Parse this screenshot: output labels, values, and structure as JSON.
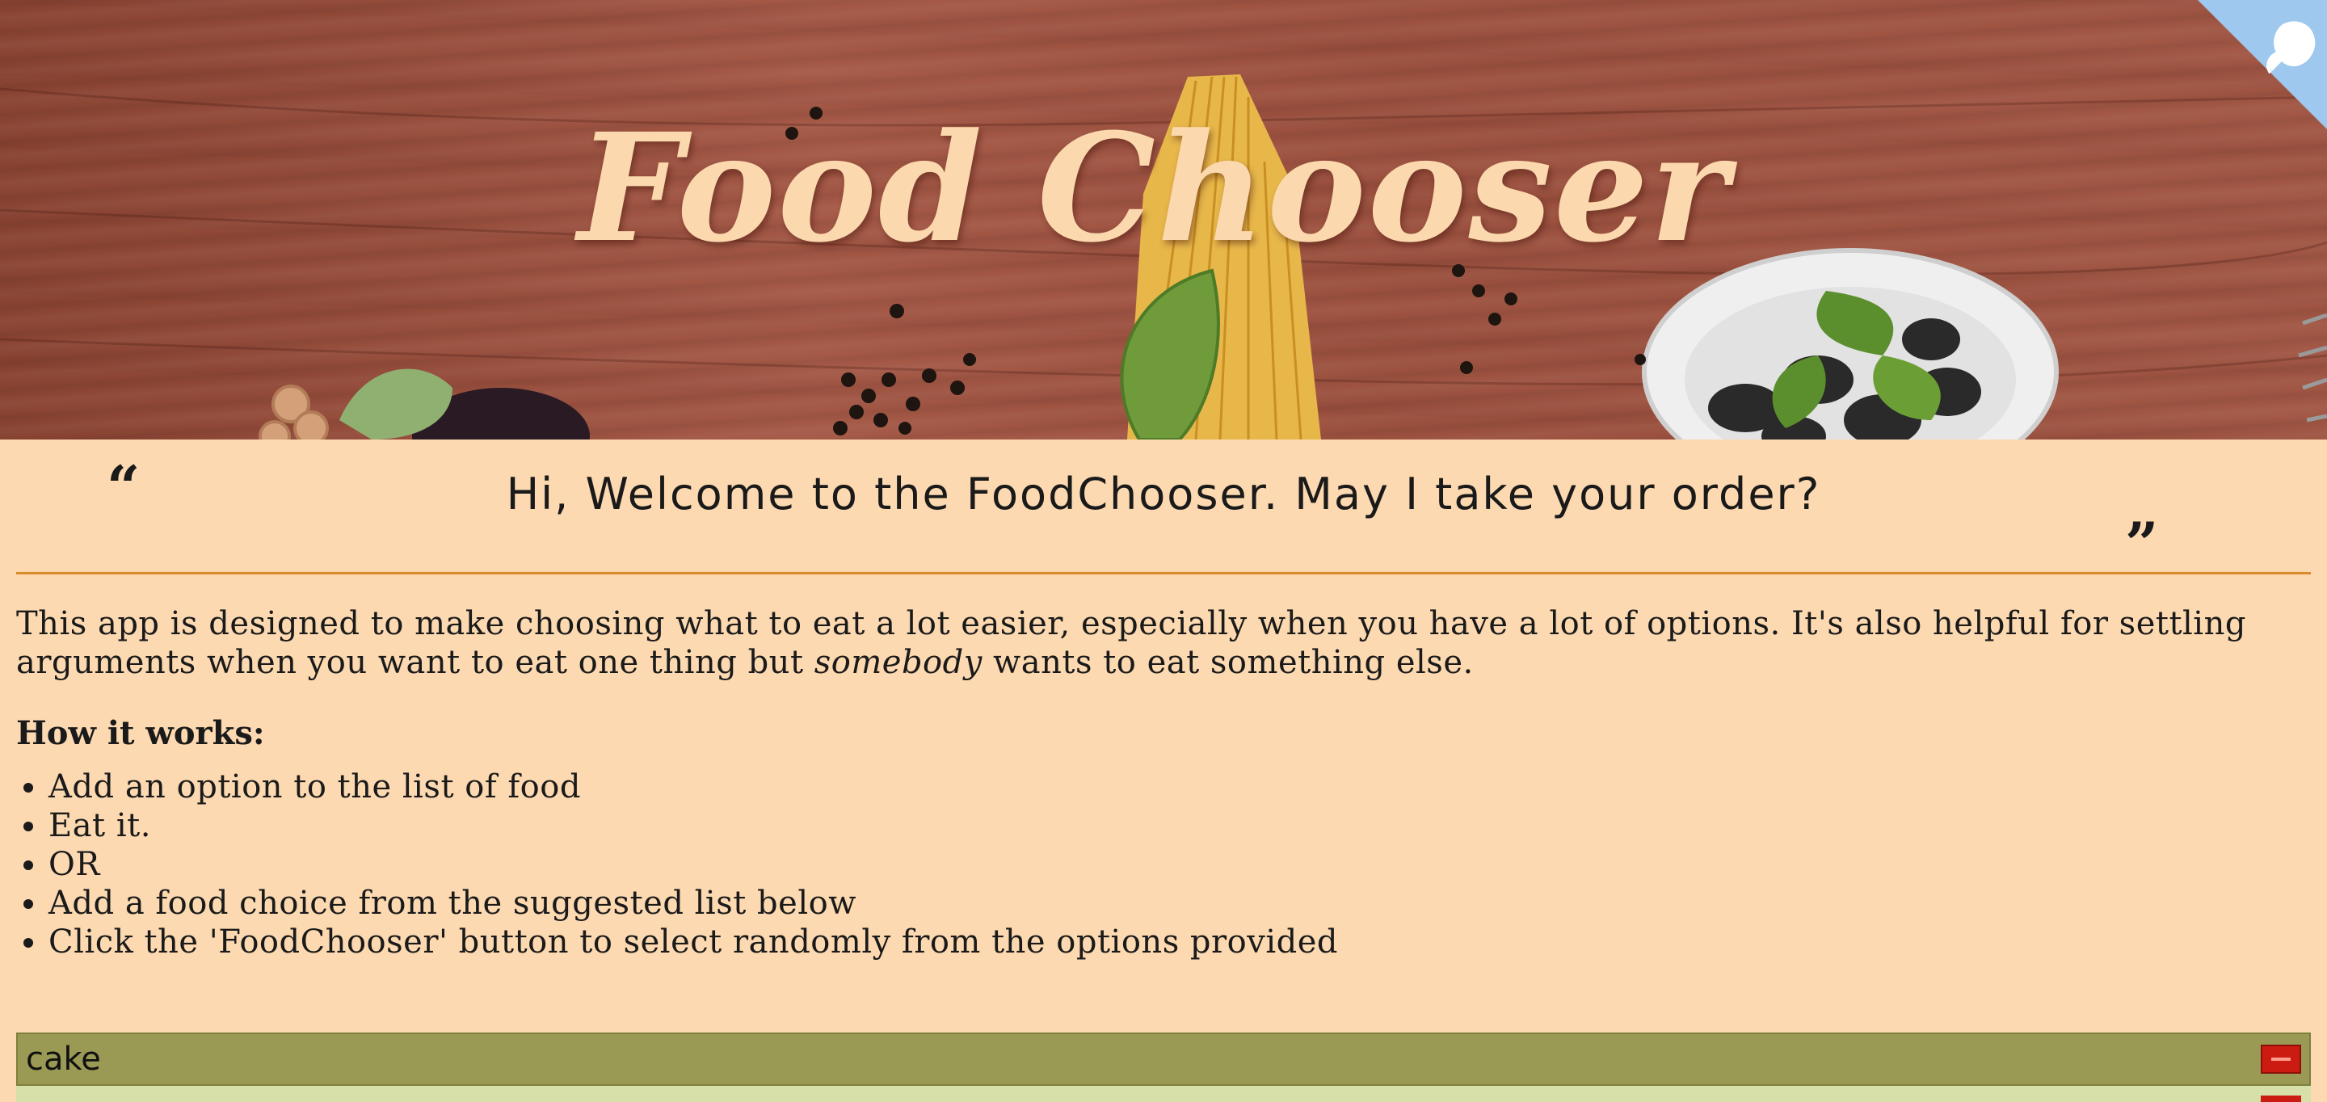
{
  "hero": {
    "title": "Food Chooser",
    "corner_icon": "octocat-icon"
  },
  "welcome": {
    "quote_open": "“",
    "message": "Hi, Welcome to the FoodChooser. May I take your order?",
    "quote_close": "”"
  },
  "intro": {
    "text_before": "This app is designed to make choosing what to eat a lot easier, especially when you have a lot of options. It's also helpful for settling arguments when you want to eat one thing but ",
    "emphasis": "somebody",
    "text_after": " wants to eat something else."
  },
  "how_it_works": {
    "heading": "How it works:",
    "steps": [
      "Add an option to the list of food",
      "Eat it.",
      "OR",
      "Add a food choice from the suggested list below",
      "Click the 'FoodChooser' button to select randomly from the options provided"
    ]
  },
  "food_list": {
    "items": [
      {
        "name": "cake",
        "remove_icon": "minus-icon"
      }
    ]
  },
  "colors": {
    "background": "#fcd9b0",
    "accent_line": "#d98b2a",
    "food_item": "#9a9a55",
    "remove_button": "#cc1c12",
    "title": "#fbd8ad"
  }
}
